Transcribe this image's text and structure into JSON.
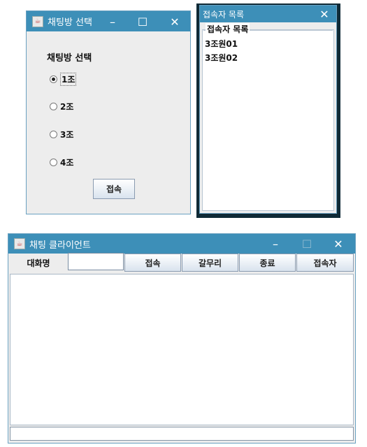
{
  "room_select": {
    "title": "채팅방 선택",
    "heading": "채팅방 선택",
    "options": [
      {
        "label": "1조",
        "selected": true
      },
      {
        "label": "2조",
        "selected": false
      },
      {
        "label": "3조",
        "selected": false
      },
      {
        "label": "4조",
        "selected": false
      }
    ],
    "connect_label": "접속"
  },
  "user_list": {
    "title": "접속자 목록",
    "group_title": "접속자 목록",
    "users": [
      "3조원01",
      "3조원02"
    ]
  },
  "chat_client": {
    "title": "채팅 클라이언트",
    "nickname_label": "대화명",
    "nickname_value": "",
    "buttons": {
      "connect": "접속",
      "switch": "갈무리",
      "exit": "종료",
      "users": "접속자"
    },
    "message_value": ""
  },
  "colors": {
    "titlebar": "#3d8fb8",
    "window_bg": "#ededed"
  }
}
